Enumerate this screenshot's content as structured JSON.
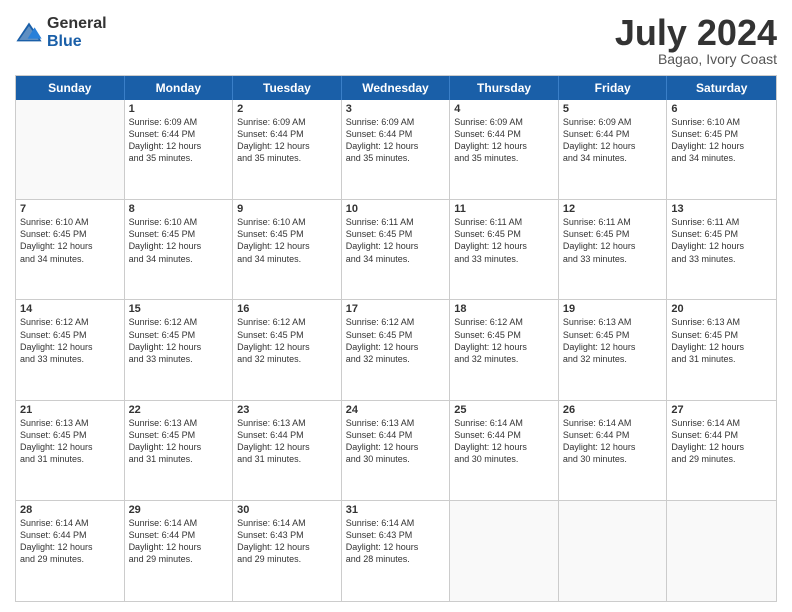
{
  "logo": {
    "general": "General",
    "blue": "Blue"
  },
  "title": {
    "month": "July 2024",
    "location": "Bagao, Ivory Coast"
  },
  "header_days": [
    "Sunday",
    "Monday",
    "Tuesday",
    "Wednesday",
    "Thursday",
    "Friday",
    "Saturday"
  ],
  "weeks": [
    [
      {
        "day": "",
        "sunrise": "",
        "sunset": "",
        "daylight": "",
        "empty": true
      },
      {
        "day": "1",
        "sunrise": "Sunrise: 6:09 AM",
        "sunset": "Sunset: 6:44 PM",
        "daylight": "Daylight: 12 hours and 35 minutes."
      },
      {
        "day": "2",
        "sunrise": "Sunrise: 6:09 AM",
        "sunset": "Sunset: 6:44 PM",
        "daylight": "Daylight: 12 hours and 35 minutes."
      },
      {
        "day": "3",
        "sunrise": "Sunrise: 6:09 AM",
        "sunset": "Sunset: 6:44 PM",
        "daylight": "Daylight: 12 hours and 35 minutes."
      },
      {
        "day": "4",
        "sunrise": "Sunrise: 6:09 AM",
        "sunset": "Sunset: 6:44 PM",
        "daylight": "Daylight: 12 hours and 35 minutes."
      },
      {
        "day": "5",
        "sunrise": "Sunrise: 6:09 AM",
        "sunset": "Sunset: 6:44 PM",
        "daylight": "Daylight: 12 hours and 34 minutes."
      },
      {
        "day": "6",
        "sunrise": "Sunrise: 6:10 AM",
        "sunset": "Sunset: 6:45 PM",
        "daylight": "Daylight: 12 hours and 34 minutes."
      }
    ],
    [
      {
        "day": "7",
        "sunrise": "Sunrise: 6:10 AM",
        "sunset": "Sunset: 6:45 PM",
        "daylight": "Daylight: 12 hours and 34 minutes."
      },
      {
        "day": "8",
        "sunrise": "Sunrise: 6:10 AM",
        "sunset": "Sunset: 6:45 PM",
        "daylight": "Daylight: 12 hours and 34 minutes."
      },
      {
        "day": "9",
        "sunrise": "Sunrise: 6:10 AM",
        "sunset": "Sunset: 6:45 PM",
        "daylight": "Daylight: 12 hours and 34 minutes."
      },
      {
        "day": "10",
        "sunrise": "Sunrise: 6:11 AM",
        "sunset": "Sunset: 6:45 PM",
        "daylight": "Daylight: 12 hours and 34 minutes."
      },
      {
        "day": "11",
        "sunrise": "Sunrise: 6:11 AM",
        "sunset": "Sunset: 6:45 PM",
        "daylight": "Daylight: 12 hours and 33 minutes."
      },
      {
        "day": "12",
        "sunrise": "Sunrise: 6:11 AM",
        "sunset": "Sunset: 6:45 PM",
        "daylight": "Daylight: 12 hours and 33 minutes."
      },
      {
        "day": "13",
        "sunrise": "Sunrise: 6:11 AM",
        "sunset": "Sunset: 6:45 PM",
        "daylight": "Daylight: 12 hours and 33 minutes."
      }
    ],
    [
      {
        "day": "14",
        "sunrise": "Sunrise: 6:12 AM",
        "sunset": "Sunset: 6:45 PM",
        "daylight": "Daylight: 12 hours and 33 minutes."
      },
      {
        "day": "15",
        "sunrise": "Sunrise: 6:12 AM",
        "sunset": "Sunset: 6:45 PM",
        "daylight": "Daylight: 12 hours and 33 minutes."
      },
      {
        "day": "16",
        "sunrise": "Sunrise: 6:12 AM",
        "sunset": "Sunset: 6:45 PM",
        "daylight": "Daylight: 12 hours and 32 minutes."
      },
      {
        "day": "17",
        "sunrise": "Sunrise: 6:12 AM",
        "sunset": "Sunset: 6:45 PM",
        "daylight": "Daylight: 12 hours and 32 minutes."
      },
      {
        "day": "18",
        "sunrise": "Sunrise: 6:12 AM",
        "sunset": "Sunset: 6:45 PM",
        "daylight": "Daylight: 12 hours and 32 minutes."
      },
      {
        "day": "19",
        "sunrise": "Sunrise: 6:13 AM",
        "sunset": "Sunset: 6:45 PM",
        "daylight": "Daylight: 12 hours and 32 minutes."
      },
      {
        "day": "20",
        "sunrise": "Sunrise: 6:13 AM",
        "sunset": "Sunset: 6:45 PM",
        "daylight": "Daylight: 12 hours and 31 minutes."
      }
    ],
    [
      {
        "day": "21",
        "sunrise": "Sunrise: 6:13 AM",
        "sunset": "Sunset: 6:45 PM",
        "daylight": "Daylight: 12 hours and 31 minutes."
      },
      {
        "day": "22",
        "sunrise": "Sunrise: 6:13 AM",
        "sunset": "Sunset: 6:45 PM",
        "daylight": "Daylight: 12 hours and 31 minutes."
      },
      {
        "day": "23",
        "sunrise": "Sunrise: 6:13 AM",
        "sunset": "Sunset: 6:44 PM",
        "daylight": "Daylight: 12 hours and 31 minutes."
      },
      {
        "day": "24",
        "sunrise": "Sunrise: 6:13 AM",
        "sunset": "Sunset: 6:44 PM",
        "daylight": "Daylight: 12 hours and 30 minutes."
      },
      {
        "day": "25",
        "sunrise": "Sunrise: 6:14 AM",
        "sunset": "Sunset: 6:44 PM",
        "daylight": "Daylight: 12 hours and 30 minutes."
      },
      {
        "day": "26",
        "sunrise": "Sunrise: 6:14 AM",
        "sunset": "Sunset: 6:44 PM",
        "daylight": "Daylight: 12 hours and 30 minutes."
      },
      {
        "day": "27",
        "sunrise": "Sunrise: 6:14 AM",
        "sunset": "Sunset: 6:44 PM",
        "daylight": "Daylight: 12 hours and 29 minutes."
      }
    ],
    [
      {
        "day": "28",
        "sunrise": "Sunrise: 6:14 AM",
        "sunset": "Sunset: 6:44 PM",
        "daylight": "Daylight: 12 hours and 29 minutes."
      },
      {
        "day": "29",
        "sunrise": "Sunrise: 6:14 AM",
        "sunset": "Sunset: 6:44 PM",
        "daylight": "Daylight: 12 hours and 29 minutes."
      },
      {
        "day": "30",
        "sunrise": "Sunrise: 6:14 AM",
        "sunset": "Sunset: 6:43 PM",
        "daylight": "Daylight: 12 hours and 29 minutes."
      },
      {
        "day": "31",
        "sunrise": "Sunrise: 6:14 AM",
        "sunset": "Sunset: 6:43 PM",
        "daylight": "Daylight: 12 hours and 28 minutes."
      },
      {
        "day": "",
        "sunrise": "",
        "sunset": "",
        "daylight": "",
        "empty": true
      },
      {
        "day": "",
        "sunrise": "",
        "sunset": "",
        "daylight": "",
        "empty": true
      },
      {
        "day": "",
        "sunrise": "",
        "sunset": "",
        "daylight": "",
        "empty": true
      }
    ]
  ]
}
